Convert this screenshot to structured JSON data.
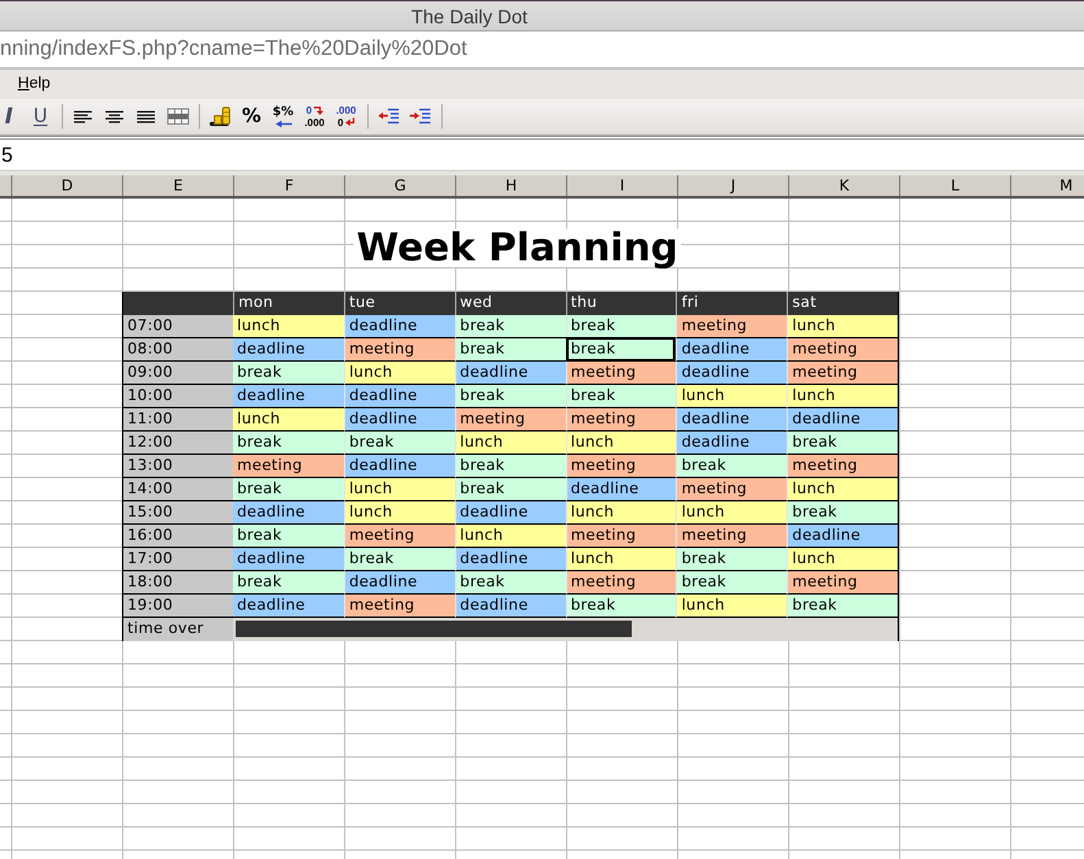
{
  "window": {
    "title": "The Daily Dot"
  },
  "address_bar": {
    "url": "nning/indexFS.php?cname=The%20Daily%20Dot"
  },
  "menu_bar": {
    "items": [
      {
        "label": "Help",
        "mnemonic_underlined": true
      }
    ]
  },
  "toolbar": {
    "groups": [
      [
        {
          "kind": "italic",
          "label": "I"
        },
        {
          "kind": "underline",
          "label": "U"
        }
      ],
      [
        {
          "kind": "align-left"
        },
        {
          "kind": "align-center"
        },
        {
          "kind": "justify"
        },
        {
          "kind": "merge-cells"
        }
      ],
      [
        {
          "kind": "coins"
        },
        {
          "kind": "percent",
          "label": "%"
        },
        {
          "kind": "currency",
          "label": "$%"
        },
        {
          "kind": "add-decimal",
          "lines": [
            "0",
            ".000"
          ]
        },
        {
          "kind": "remove-decimal",
          "lines": [
            ".000",
            "0"
          ]
        }
      ],
      [
        {
          "kind": "outdent"
        },
        {
          "kind": "indent"
        }
      ]
    ]
  },
  "formula_bar": {
    "value": "5"
  },
  "sheet": {
    "column_headers": [
      "D",
      "E",
      "F",
      "G",
      "H",
      "I",
      "J",
      "K",
      "L",
      "M"
    ],
    "title": "Week Planning",
    "planner": {
      "days": [
        "mon",
        "tue",
        "wed",
        "thu",
        "fri",
        "sat"
      ],
      "rows": [
        {
          "time": "07:00",
          "cells": [
            {
              "text": "lunch",
              "color": "#ffff99",
              "selected": false
            },
            {
              "text": "deadline",
              "color": "#99ccff",
              "selected": false
            },
            {
              "text": "break",
              "color": "#ccffdd",
              "selected": false
            },
            {
              "text": "break",
              "color": "#ccffdd",
              "selected": false
            },
            {
              "text": "meeting",
              "color": "#ffbb99",
              "selected": false
            },
            {
              "text": "lunch",
              "color": "#ffff99",
              "selected": false
            }
          ]
        },
        {
          "time": "08:00",
          "cells": [
            {
              "text": "deadline",
              "color": "#99ccff",
              "selected": false
            },
            {
              "text": "meeting",
              "color": "#ffbb99",
              "selected": false
            },
            {
              "text": "break",
              "color": "#ccffdd",
              "selected": false
            },
            {
              "text": "break",
              "color": "#ccffdd",
              "selected": true
            },
            {
              "text": "deadline",
              "color": "#99ccff",
              "selected": false
            },
            {
              "text": "meeting",
              "color": "#ffbb99",
              "selected": false
            }
          ]
        },
        {
          "time": "09:00",
          "cells": [
            {
              "text": "break",
              "color": "#ccffdd",
              "selected": false
            },
            {
              "text": "lunch",
              "color": "#ffff99",
              "selected": false
            },
            {
              "text": "deadline",
              "color": "#99ccff",
              "selected": false
            },
            {
              "text": "meeting",
              "color": "#ffbb99",
              "selected": false
            },
            {
              "text": "deadline",
              "color": "#99ccff",
              "selected": false
            },
            {
              "text": "meeting",
              "color": "#ffbb99",
              "selected": false
            }
          ]
        },
        {
          "time": "10:00",
          "cells": [
            {
              "text": "deadline",
              "color": "#99ccff",
              "selected": false
            },
            {
              "text": "deadline",
              "color": "#99ccff",
              "selected": false
            },
            {
              "text": "break",
              "color": "#ccffdd",
              "selected": false
            },
            {
              "text": "break",
              "color": "#ccffdd",
              "selected": false
            },
            {
              "text": "lunch",
              "color": "#ffff99",
              "selected": false
            },
            {
              "text": "lunch",
              "color": "#ffff99",
              "selected": false
            }
          ]
        },
        {
          "time": "11:00",
          "cells": [
            {
              "text": "lunch",
              "color": "#ffff99",
              "selected": false
            },
            {
              "text": "deadline",
              "color": "#99ccff",
              "selected": false
            },
            {
              "text": "meeting",
              "color": "#ffbb99",
              "selected": false
            },
            {
              "text": "meeting",
              "color": "#ffbb99",
              "selected": false
            },
            {
              "text": "deadline",
              "color": "#99ccff",
              "selected": false
            },
            {
              "text": "deadline",
              "color": "#99ccff",
              "selected": false
            }
          ]
        },
        {
          "time": "12:00",
          "cells": [
            {
              "text": "break",
              "color": "#ccffdd",
              "selected": false
            },
            {
              "text": "break",
              "color": "#ccffdd",
              "selected": false
            },
            {
              "text": "lunch",
              "color": "#ffff99",
              "selected": false
            },
            {
              "text": "lunch",
              "color": "#ffff99",
              "selected": false
            },
            {
              "text": "deadline",
              "color": "#99ccff",
              "selected": false
            },
            {
              "text": "break",
              "color": "#ccffdd",
              "selected": false
            }
          ]
        },
        {
          "time": "13:00",
          "cells": [
            {
              "text": "meeting",
              "color": "#ffbb99",
              "selected": false
            },
            {
              "text": "deadline",
              "color": "#99ccff",
              "selected": false
            },
            {
              "text": "break",
              "color": "#ccffdd",
              "selected": false
            },
            {
              "text": "meeting",
              "color": "#ffbb99",
              "selected": false
            },
            {
              "text": "break",
              "color": "#ccffdd",
              "selected": false
            },
            {
              "text": "meeting",
              "color": "#ffbb99",
              "selected": false
            }
          ]
        },
        {
          "time": "14:00",
          "cells": [
            {
              "text": "break",
              "color": "#ccffdd",
              "selected": false
            },
            {
              "text": "lunch",
              "color": "#ffff99",
              "selected": false
            },
            {
              "text": "break",
              "color": "#ccffdd",
              "selected": false
            },
            {
              "text": "deadline",
              "color": "#99ccff",
              "selected": false
            },
            {
              "text": "meeting",
              "color": "#ffbb99",
              "selected": false
            },
            {
              "text": "lunch",
              "color": "#ffff99",
              "selected": false
            }
          ]
        },
        {
          "time": "15:00",
          "cells": [
            {
              "text": "deadline",
              "color": "#99ccff",
              "selected": false
            },
            {
              "text": "lunch",
              "color": "#ffff99",
              "selected": false
            },
            {
              "text": "deadline",
              "color": "#99ccff",
              "selected": false
            },
            {
              "text": "lunch",
              "color": "#ffff99",
              "selected": false
            },
            {
              "text": "lunch",
              "color": "#ffff99",
              "selected": false
            },
            {
              "text": "break",
              "color": "#ccffdd",
              "selected": false
            }
          ]
        },
        {
          "time": "16:00",
          "cells": [
            {
              "text": "break",
              "color": "#ccffdd",
              "selected": false
            },
            {
              "text": "meeting",
              "color": "#ffbb99",
              "selected": false
            },
            {
              "text": "lunch",
              "color": "#ffff99",
              "selected": false
            },
            {
              "text": "meeting",
              "color": "#ffbb99",
              "selected": false
            },
            {
              "text": "meeting",
              "color": "#ffbb99",
              "selected": false
            },
            {
              "text": "deadline",
              "color": "#99ccff",
              "selected": false
            }
          ]
        },
        {
          "time": "17:00",
          "cells": [
            {
              "text": "deadline",
              "color": "#99ccff",
              "selected": false
            },
            {
              "text": "break",
              "color": "#ccffdd",
              "selected": false
            },
            {
              "text": "deadline",
              "color": "#99ccff",
              "selected": false
            },
            {
              "text": "lunch",
              "color": "#ffff99",
              "selected": false
            },
            {
              "text": "break",
              "color": "#ccffdd",
              "selected": false
            },
            {
              "text": "lunch",
              "color": "#ffff99",
              "selected": false
            }
          ]
        },
        {
          "time": "18:00",
          "cells": [
            {
              "text": "break",
              "color": "#ccffdd",
              "selected": false
            },
            {
              "text": "deadline",
              "color": "#99ccff",
              "selected": false
            },
            {
              "text": "break",
              "color": "#ccffdd",
              "selected": false
            },
            {
              "text": "meeting",
              "color": "#ffbb99",
              "selected": false
            },
            {
              "text": "break",
              "color": "#ccffdd",
              "selected": false
            },
            {
              "text": "meeting",
              "color": "#ffbb99",
              "selected": false
            }
          ]
        },
        {
          "time": "19:00",
          "cells": [
            {
              "text": "deadline",
              "color": "#99ccff",
              "selected": false
            },
            {
              "text": "meeting",
              "color": "#ffbb99",
              "selected": false
            },
            {
              "text": "deadline",
              "color": "#99ccff",
              "selected": false
            },
            {
              "text": "break",
              "color": "#ccffdd",
              "selected": false
            },
            {
              "text": "lunch",
              "color": "#ffff99",
              "selected": false
            },
            {
              "text": "break",
              "color": "#ccffdd",
              "selected": false
            }
          ]
        }
      ],
      "time_over": {
        "label": "time over",
        "level": 0.6
      }
    }
  }
}
